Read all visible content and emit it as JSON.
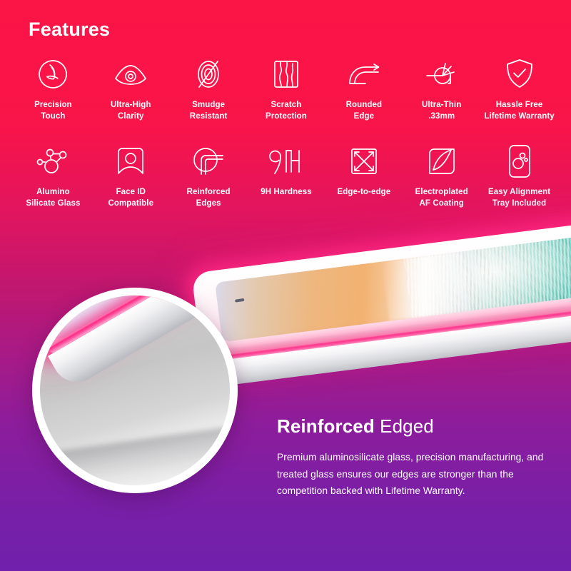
{
  "heading": "Features",
  "features": [
    {
      "icon": "precision-touch-icon",
      "label": "Precision\nTouch"
    },
    {
      "icon": "eye-clarity-icon",
      "label": "Ultra-High\nClarity"
    },
    {
      "icon": "smudge-resistant-icon",
      "label": "Smudge\nResistant"
    },
    {
      "icon": "scratch-protection-icon",
      "label": "Scratch\nProtection"
    },
    {
      "icon": "rounded-edge-icon",
      "label": "Rounded\nEdge"
    },
    {
      "icon": "ultra-thin-icon",
      "label": "Ultra-Thin\n.33mm"
    },
    {
      "icon": "shield-warranty-icon",
      "label": "Hassle Free\nLifetime Warranty"
    },
    {
      "icon": "alumino-silicate-icon",
      "label": "Alumino\nSilicate Glass"
    },
    {
      "icon": "face-id-icon",
      "label": "Face ID\nCompatible"
    },
    {
      "icon": "reinforced-edges-icon",
      "label": "Reinforced\nEdges"
    },
    {
      "icon": "nine-h-hardness-icon",
      "label": "9H Hardness"
    },
    {
      "icon": "edge-to-edge-icon",
      "label": "Edge-to-edge"
    },
    {
      "icon": "electroplated-coating-icon",
      "label": "Electroplated\nAF Coating"
    },
    {
      "icon": "easy-alignment-tray-icon",
      "label": "Easy Alignment\nTray Included"
    }
  ],
  "copy": {
    "title_bold": "Reinforced",
    "title_light": " Edged",
    "body": "Premium aluminosilicate glass, precision manufacturing, and treated glass ensures our edges are stronger than the competition backed with Lifetime Warranty."
  },
  "colors": {
    "gradient_top": "#FB1446",
    "gradient_mid": "#B01880",
    "gradient_bottom": "#7020AC",
    "icon_stroke": "#FFFFFF",
    "edge_glow": "#FF2388"
  },
  "product": {
    "magnifier": "edge-magnifier-circle",
    "device": "tablet-with-beach-wallpaper"
  }
}
